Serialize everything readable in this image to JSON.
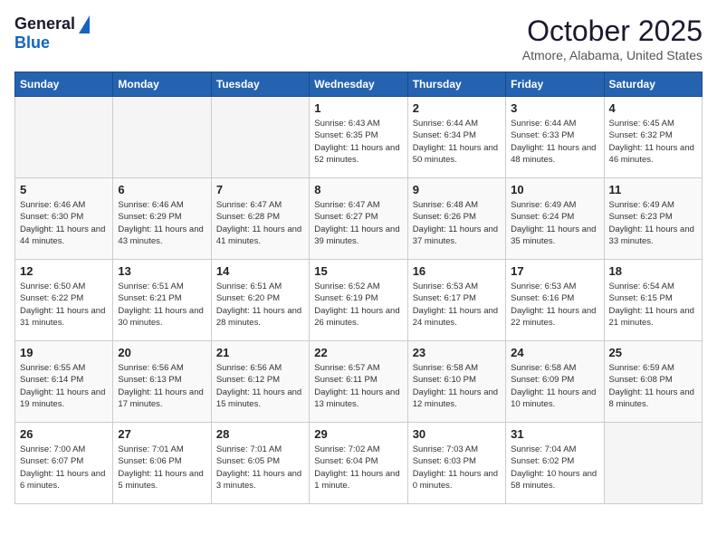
{
  "header": {
    "logo_general": "General",
    "logo_blue": "Blue",
    "month": "October 2025",
    "location": "Atmore, Alabama, United States"
  },
  "weekdays": [
    "Sunday",
    "Monday",
    "Tuesday",
    "Wednesday",
    "Thursday",
    "Friday",
    "Saturday"
  ],
  "weeks": [
    [
      {
        "day": "",
        "info": ""
      },
      {
        "day": "",
        "info": ""
      },
      {
        "day": "",
        "info": ""
      },
      {
        "day": "1",
        "info": "Sunrise: 6:43 AM\nSunset: 6:35 PM\nDaylight: 11 hours and 52 minutes."
      },
      {
        "day": "2",
        "info": "Sunrise: 6:44 AM\nSunset: 6:34 PM\nDaylight: 11 hours and 50 minutes."
      },
      {
        "day": "3",
        "info": "Sunrise: 6:44 AM\nSunset: 6:33 PM\nDaylight: 11 hours and 48 minutes."
      },
      {
        "day": "4",
        "info": "Sunrise: 6:45 AM\nSunset: 6:32 PM\nDaylight: 11 hours and 46 minutes."
      }
    ],
    [
      {
        "day": "5",
        "info": "Sunrise: 6:46 AM\nSunset: 6:30 PM\nDaylight: 11 hours and 44 minutes."
      },
      {
        "day": "6",
        "info": "Sunrise: 6:46 AM\nSunset: 6:29 PM\nDaylight: 11 hours and 43 minutes."
      },
      {
        "day": "7",
        "info": "Sunrise: 6:47 AM\nSunset: 6:28 PM\nDaylight: 11 hours and 41 minutes."
      },
      {
        "day": "8",
        "info": "Sunrise: 6:47 AM\nSunset: 6:27 PM\nDaylight: 11 hours and 39 minutes."
      },
      {
        "day": "9",
        "info": "Sunrise: 6:48 AM\nSunset: 6:26 PM\nDaylight: 11 hours and 37 minutes."
      },
      {
        "day": "10",
        "info": "Sunrise: 6:49 AM\nSunset: 6:24 PM\nDaylight: 11 hours and 35 minutes."
      },
      {
        "day": "11",
        "info": "Sunrise: 6:49 AM\nSunset: 6:23 PM\nDaylight: 11 hours and 33 minutes."
      }
    ],
    [
      {
        "day": "12",
        "info": "Sunrise: 6:50 AM\nSunset: 6:22 PM\nDaylight: 11 hours and 31 minutes."
      },
      {
        "day": "13",
        "info": "Sunrise: 6:51 AM\nSunset: 6:21 PM\nDaylight: 11 hours and 30 minutes."
      },
      {
        "day": "14",
        "info": "Sunrise: 6:51 AM\nSunset: 6:20 PM\nDaylight: 11 hours and 28 minutes."
      },
      {
        "day": "15",
        "info": "Sunrise: 6:52 AM\nSunset: 6:19 PM\nDaylight: 11 hours and 26 minutes."
      },
      {
        "day": "16",
        "info": "Sunrise: 6:53 AM\nSunset: 6:17 PM\nDaylight: 11 hours and 24 minutes."
      },
      {
        "day": "17",
        "info": "Sunrise: 6:53 AM\nSunset: 6:16 PM\nDaylight: 11 hours and 22 minutes."
      },
      {
        "day": "18",
        "info": "Sunrise: 6:54 AM\nSunset: 6:15 PM\nDaylight: 11 hours and 21 minutes."
      }
    ],
    [
      {
        "day": "19",
        "info": "Sunrise: 6:55 AM\nSunset: 6:14 PM\nDaylight: 11 hours and 19 minutes."
      },
      {
        "day": "20",
        "info": "Sunrise: 6:56 AM\nSunset: 6:13 PM\nDaylight: 11 hours and 17 minutes."
      },
      {
        "day": "21",
        "info": "Sunrise: 6:56 AM\nSunset: 6:12 PM\nDaylight: 11 hours and 15 minutes."
      },
      {
        "day": "22",
        "info": "Sunrise: 6:57 AM\nSunset: 6:11 PM\nDaylight: 11 hours and 13 minutes."
      },
      {
        "day": "23",
        "info": "Sunrise: 6:58 AM\nSunset: 6:10 PM\nDaylight: 11 hours and 12 minutes."
      },
      {
        "day": "24",
        "info": "Sunrise: 6:58 AM\nSunset: 6:09 PM\nDaylight: 11 hours and 10 minutes."
      },
      {
        "day": "25",
        "info": "Sunrise: 6:59 AM\nSunset: 6:08 PM\nDaylight: 11 hours and 8 minutes."
      }
    ],
    [
      {
        "day": "26",
        "info": "Sunrise: 7:00 AM\nSunset: 6:07 PM\nDaylight: 11 hours and 6 minutes."
      },
      {
        "day": "27",
        "info": "Sunrise: 7:01 AM\nSunset: 6:06 PM\nDaylight: 11 hours and 5 minutes."
      },
      {
        "day": "28",
        "info": "Sunrise: 7:01 AM\nSunset: 6:05 PM\nDaylight: 11 hours and 3 minutes."
      },
      {
        "day": "29",
        "info": "Sunrise: 7:02 AM\nSunset: 6:04 PM\nDaylight: 11 hours and 1 minute."
      },
      {
        "day": "30",
        "info": "Sunrise: 7:03 AM\nSunset: 6:03 PM\nDaylight: 11 hours and 0 minutes."
      },
      {
        "day": "31",
        "info": "Sunrise: 7:04 AM\nSunset: 6:02 PM\nDaylight: 10 hours and 58 minutes."
      },
      {
        "day": "",
        "info": ""
      }
    ]
  ]
}
